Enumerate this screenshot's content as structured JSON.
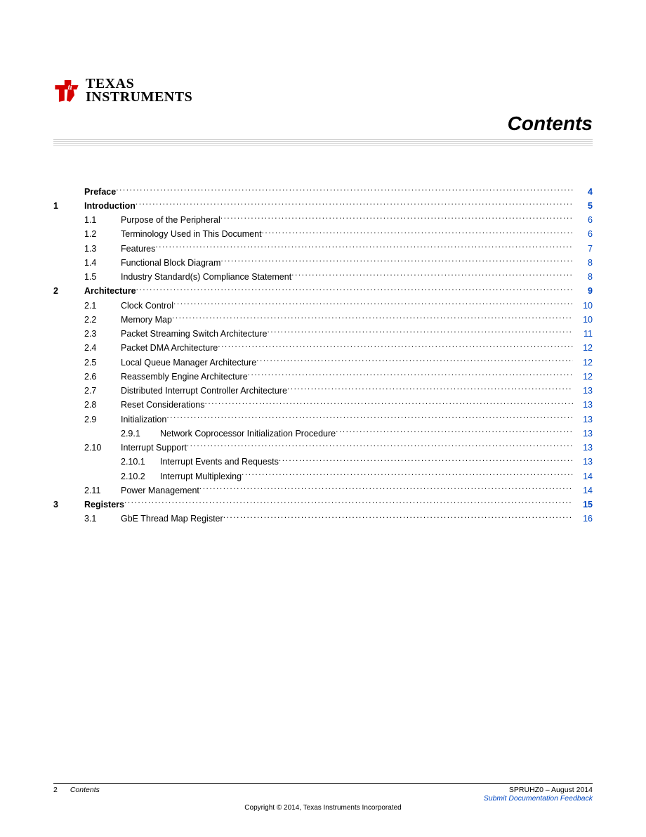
{
  "logo": {
    "top": "TEXAS",
    "bot": "INSTRUMENTS"
  },
  "title": "Contents",
  "toc": [
    {
      "level": 0,
      "num": "",
      "label": "Preface",
      "page": "4"
    },
    {
      "level": 0,
      "num": "1",
      "label": "Introduction",
      "page": "5"
    },
    {
      "level": 1,
      "num": "1.1",
      "label": "Purpose of the Peripheral",
      "page": "6"
    },
    {
      "level": 1,
      "num": "1.2",
      "label": "Terminology Used in This Document",
      "page": "6"
    },
    {
      "level": 1,
      "num": "1.3",
      "label": "Features",
      "page": "7"
    },
    {
      "level": 1,
      "num": "1.4",
      "label": "Functional Block Diagram",
      "page": "8"
    },
    {
      "level": 1,
      "num": "1.5",
      "label": "Industry Standard(s) Compliance Statement",
      "page": "8"
    },
    {
      "level": 0,
      "num": "2",
      "label": "Architecture",
      "page": "9"
    },
    {
      "level": 1,
      "num": "2.1",
      "label": "Clock Control",
      "page": "10"
    },
    {
      "level": 1,
      "num": "2.2",
      "label": "Memory Map",
      "page": "10"
    },
    {
      "level": 1,
      "num": "2.3",
      "label": "Packet Streaming Switch Architecture",
      "page": "11"
    },
    {
      "level": 1,
      "num": "2.4",
      "label": "Packet DMA Architecture",
      "page": "12"
    },
    {
      "level": 1,
      "num": "2.5",
      "label": "Local Queue Manager Architecture",
      "page": "12"
    },
    {
      "level": 1,
      "num": "2.6",
      "label": "Reassembly Engine Architecture",
      "page": "12"
    },
    {
      "level": 1,
      "num": "2.7",
      "label": "Distributed Interrupt Controller Architecture",
      "page": "13"
    },
    {
      "level": 1,
      "num": "2.8",
      "label": "Reset Considerations",
      "page": "13"
    },
    {
      "level": 1,
      "num": "2.9",
      "label": "Initialization",
      "page": "13"
    },
    {
      "level": 2,
      "num": "2.9.1",
      "label": "Network Coprocessor Initialization Procedure",
      "page": "13"
    },
    {
      "level": 1,
      "num": "2.10",
      "label": "Interrupt Support",
      "page": "13"
    },
    {
      "level": 2,
      "num": "2.10.1",
      "label": "Interrupt Events and Requests",
      "page": "13"
    },
    {
      "level": 2,
      "num": "2.10.2",
      "label": "Interrupt Multiplexing",
      "page": "14"
    },
    {
      "level": 1,
      "num": "2.11",
      "label": "Power Management",
      "page": "14"
    },
    {
      "level": 0,
      "num": "3",
      "label": "Registers",
      "page": "15"
    },
    {
      "level": 1,
      "num": "3.1",
      "label": "GbE Thread Map Register",
      "page": "16"
    }
  ],
  "footer": {
    "pageNumber": "2",
    "section": "Contents",
    "docId": "SPRUHZ0 – August 2014",
    "feedbackLink": "Submit Documentation Feedback",
    "copyright": "Copyright © 2014, Texas Instruments Incorporated"
  }
}
